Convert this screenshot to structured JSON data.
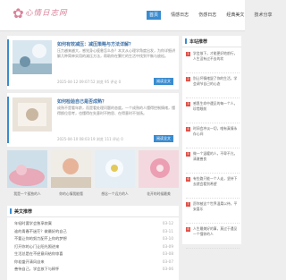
{
  "brand": {
    "logo_text": "心情日志网"
  },
  "nav": {
    "items": [
      "首页",
      "情感日志",
      "伤感日志",
      "经典美文",
      "技术分享"
    ],
    "active": 0
  },
  "posts": [
    {
      "title": "如何有效减压：减压策略与方法详解？",
      "summary": "压力越来越大，感觉身心疲惫怎么办？本文从心理学角度出发，为你详细讲解几种简单实用的减压方法，帮助你在繁忙的生活中找到平衡与放松。",
      "meta": "2025-04-12 09:07:52 浏览 95 评论 0",
      "more": "阅读全文"
    },
    {
      "title": "如何检验自己是否成熟？",
      "summary": "成熟不是看年龄，而是看处理问题的态度。一个成熟的人懂得控制情绪，懂得换位思考，也懂得在失意时不抱怨、在得意时不张扬。",
      "meta": "2025-04-10 08:03:19 浏览 111 评论 0",
      "more": "阅读全文"
    }
  ],
  "gallery": [
    {
      "caption": "我是一个孤独的人"
    },
    {
      "caption": "你的心情我能懂"
    },
    {
      "caption": "想念一个远方的人"
    },
    {
      "caption": "花开的时候最美"
    }
  ],
  "article_section": {
    "title": "美文推荐",
    "items": [
      {
        "title": "年轻时要学会独享寂寞",
        "date": "03-12"
      },
      {
        "title": "谁的青春不迷茫？做最好的自己",
        "date": "03-11"
      },
      {
        "title": "不要让你的努力配不上你的梦想",
        "date": "03-10"
      },
      {
        "title": "打开你的心门让阳光照进来",
        "date": "03-09"
      },
      {
        "title": "生活总是在不经意间给你惊喜",
        "date": "03-08"
      },
      {
        "title": "你若盛开清风自来",
        "date": "03-07"
      },
      {
        "title": "善待自己，学会放下与释怀",
        "date": "03-06"
      }
    ]
  },
  "sidebar": {
    "title": "本站推荐",
    "items": [
      {
        "num": "1",
        "text": "学会放下，才能更好地前行，人生没有过不去的坎"
      },
      {
        "num": "2",
        "text": "别让坏情绪毁了你的生活，学会调节自己的心态"
      },
      {
        "num": "3",
        "text": "感恩生命中遇见的每一个人，珍惜眼前"
      },
      {
        "num": "4",
        "text": "时间会冲淡一切，唯有真情永存心间"
      },
      {
        "num": "5",
        "text": "做一个温暖的人，不卑不亢，清澈善良"
      },
      {
        "num": "6",
        "text": "有些路只能一个人走，坚持下去就会看到希望"
      },
      {
        "num": "7",
        "text": "愿你被这个世界温柔以待，平安喜乐"
      },
      {
        "num": "8",
        "text": "人生最美好的事，莫过于遇见一个懂你的人"
      }
    ]
  },
  "colors": {
    "accent": "#3a8cd0",
    "brand": "#d9829a",
    "badge": "#e0534a"
  }
}
